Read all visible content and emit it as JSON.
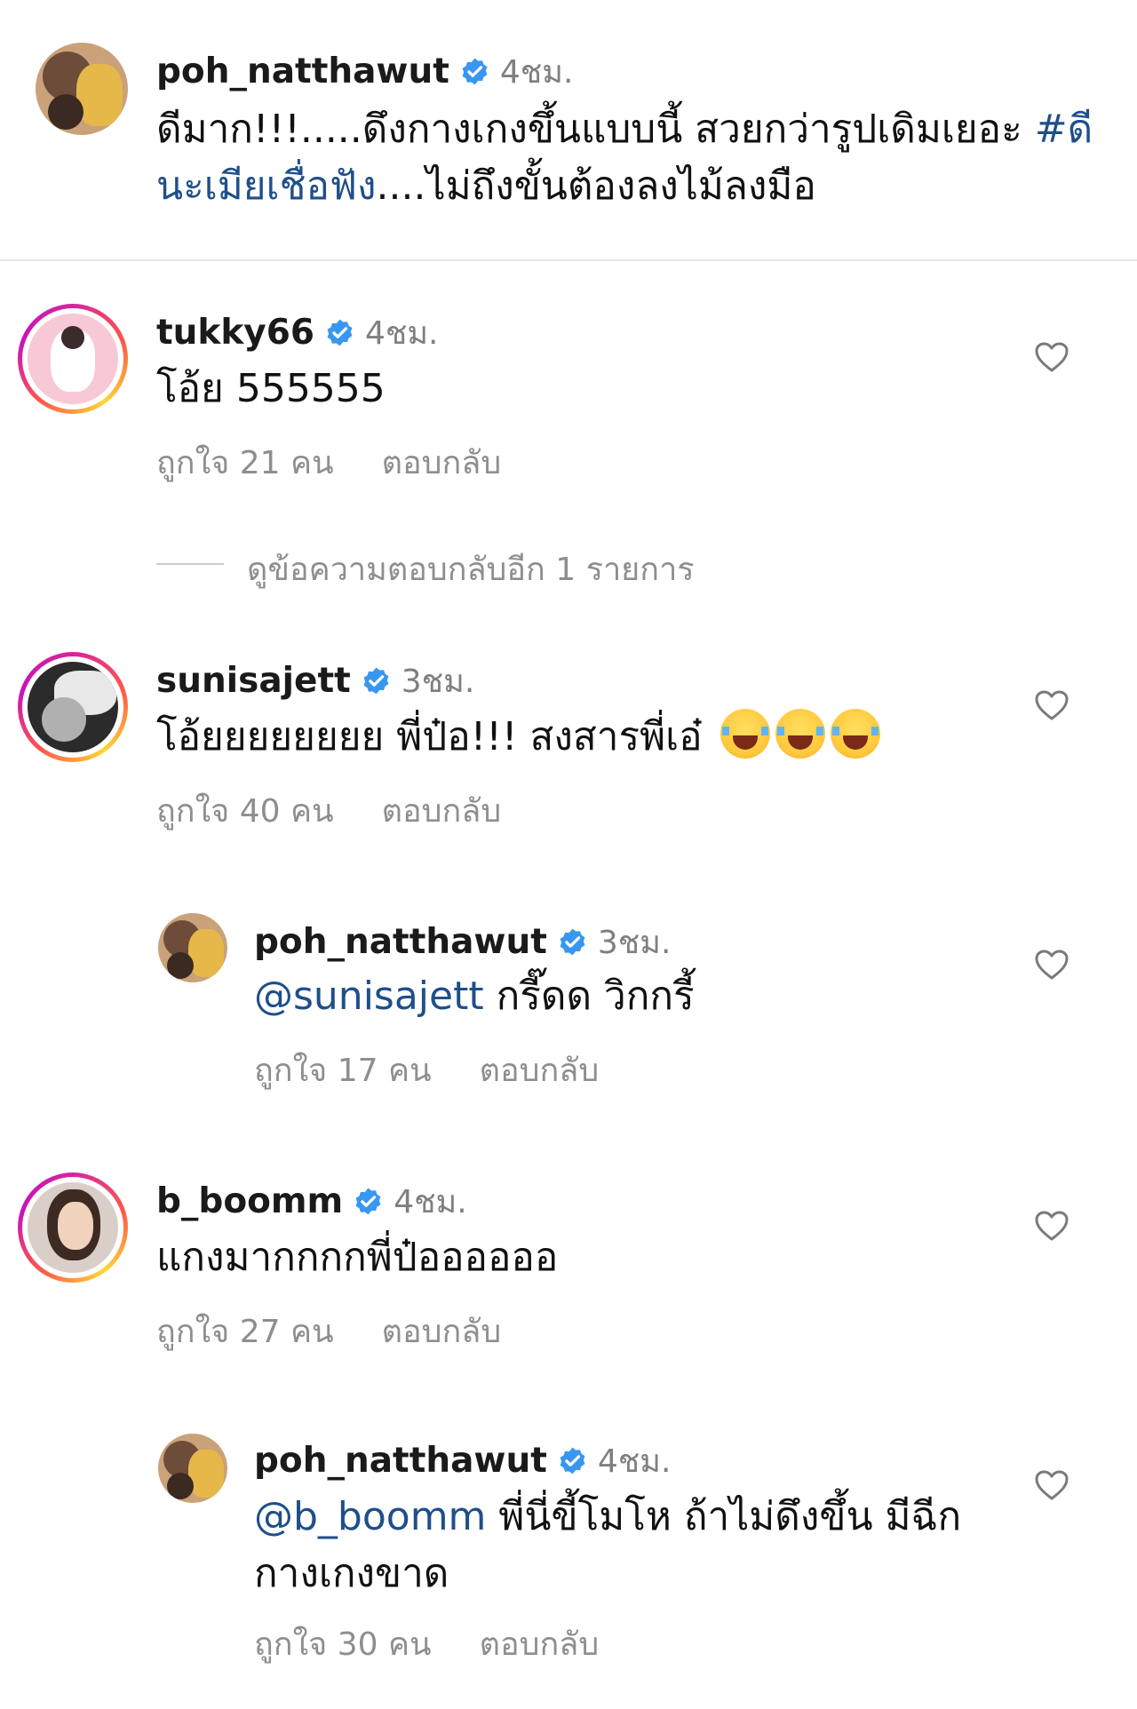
{
  "post_caption": {
    "username": "poh_natthawut",
    "time": "4ชม.",
    "text_line1": "ดีมาก!!!.....ดึงกางเกงขึ้นแบบนี้ สวยกว่ารูปเดิมเยอะ ",
    "hashtag_part1": "#ดี",
    "hashtag_part2": "นะเมียเชื่อฟัง",
    "text_line2": "....ไม่ถึงขั้นต้องลงไม้ลงมือ"
  },
  "comments": [
    {
      "username": "tukky66",
      "time": "4ชม.",
      "text": "โอ้ย 555555",
      "likes": "ถูกใจ 21 คน",
      "reply_label": "ตอบกลับ",
      "view_more": "ดูข้อความตอบกลับอีก 1 รายการ"
    },
    {
      "username": "sunisajett",
      "time": "3ชม.",
      "text": "โอ้ยยยยยยยย พี่ป๋อ!!! สงสารพี่เอ๋",
      "likes": "ถูกใจ 40 คน",
      "reply_label": "ตอบกลับ"
    },
    {
      "username": "poh_natthawut",
      "time": "3ชม.",
      "mention": "@sunisajett",
      "text": " กรี๊ดด วิกกรี้",
      "likes": "ถูกใจ 17 คน",
      "reply_label": "ตอบกลับ"
    },
    {
      "username": "b_boomm",
      "time": "4ชม.",
      "text": "แกงมากกกกพี่ป๋ออออออ",
      "likes": "ถูกใจ 27 คน",
      "reply_label": "ตอบกลับ"
    },
    {
      "username": "poh_natthawut",
      "time": "4ชม.",
      "mention": "@b_boomm",
      "text": " พี่นี่ขี้โมโห ถ้าไม่ดึงขึ้น มีฉีก",
      "text_line2": "กางเกงขาด",
      "likes": "ถูกใจ 30 คน",
      "reply_label": "ตอบกลับ"
    }
  ],
  "icons": {
    "verified": "verified-badge-icon",
    "heart": "heart-outline-icon",
    "emoji": "face-with-tears-of-joy"
  },
  "colors": {
    "verified_blue": "#3897f0",
    "link_blue": "#1f4f8a",
    "meta_gray": "#8e8e8e"
  }
}
